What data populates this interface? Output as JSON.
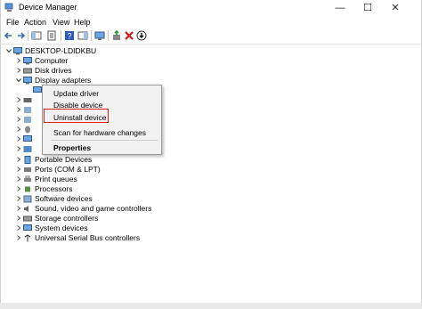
{
  "window": {
    "title": "Device Manager"
  },
  "menubar": [
    "File",
    "Action",
    "View",
    "Help"
  ],
  "tree": {
    "root": "DESKTOP-LDIDKBU",
    "items": [
      "Computer",
      "Disk drives",
      "Display adapters",
      "",
      "",
      "",
      "",
      "",
      "",
      "",
      "",
      "Portable Devices",
      "Ports (COM & LPT)",
      "Print queues",
      "Processors",
      "Software devices",
      "Sound, video and game controllers",
      "Storage controllers",
      "System devices",
      "Universal Serial Bus controllers"
    ]
  },
  "context_menu": {
    "items": [
      "Update driver",
      "Disable device",
      "Uninstall device",
      "Scan for hardware changes",
      "Properties"
    ],
    "highlighted": "Uninstall device"
  },
  "colors": {
    "highlight_border": "#e02020",
    "uninstall_red_x": "#d01818",
    "enable_green": "#2a9a3a"
  }
}
